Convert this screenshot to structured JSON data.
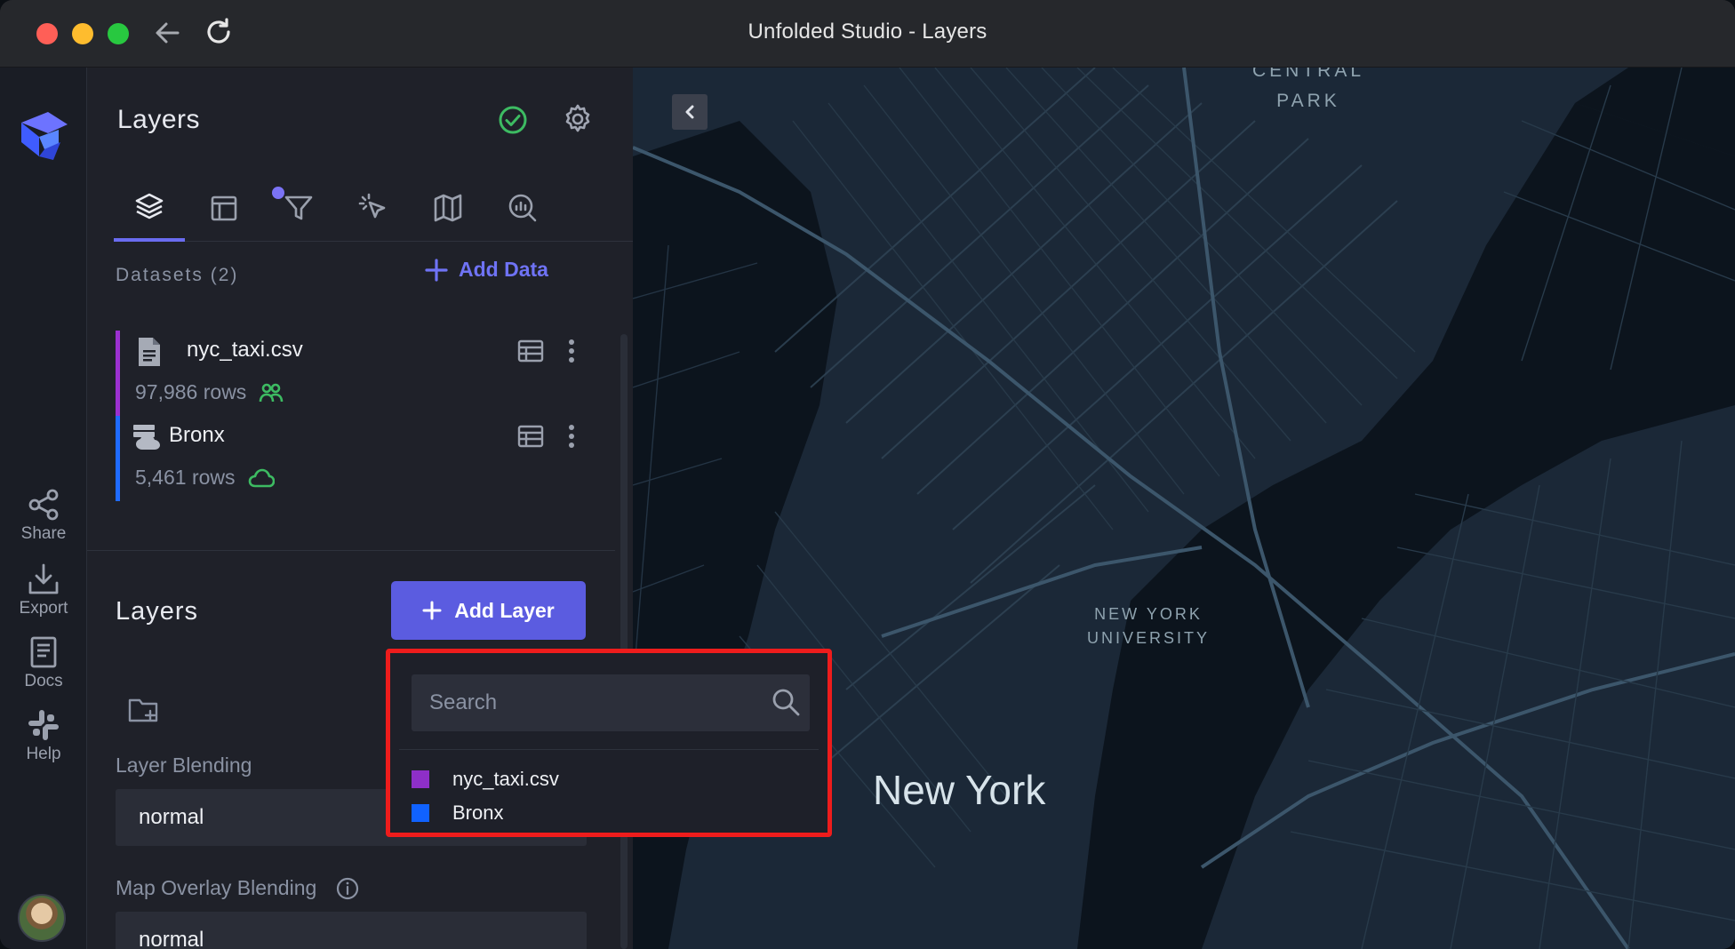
{
  "window": {
    "title": "Unfolded Studio - Layers"
  },
  "rail": {
    "items": [
      {
        "label": "Share",
        "icon": "share-icon"
      },
      {
        "label": "Export",
        "icon": "export-icon"
      },
      {
        "label": "Docs",
        "icon": "docs-icon"
      },
      {
        "label": "Help",
        "icon": "slack-icon"
      }
    ]
  },
  "panel": {
    "title": "Layers",
    "tabs": [
      {
        "name": "layers",
        "icon": "layers-icon"
      },
      {
        "name": "base-map",
        "icon": "layout-icon"
      },
      {
        "name": "filters",
        "icon": "filter-icon"
      },
      {
        "name": "interactions",
        "icon": "cursor-icon"
      },
      {
        "name": "map-style",
        "icon": "map-icon"
      },
      {
        "name": "analytics",
        "icon": "analytics-icon"
      }
    ],
    "datasets_header": "Datasets (2)",
    "add_data_label": "Add Data",
    "datasets": [
      {
        "name": "nyc_taxi.csv",
        "rows": "97,986 rows",
        "color": "#9b30d0"
      },
      {
        "name": "Bronx",
        "rows": "5,461 rows",
        "color": "#1f6bff"
      }
    ],
    "layers_title": "Layers",
    "add_layer_label": "Add Layer",
    "layer_blending_label": "Layer Blending",
    "layer_blending_value": "normal",
    "overlay_blending_label": "Map Overlay Blending",
    "overlay_blending_value": "normal"
  },
  "dropdown": {
    "search_placeholder": "Search",
    "items": [
      {
        "label": "nyc_taxi.csv",
        "color": "#8e2fc8"
      },
      {
        "label": "Bronx",
        "color": "#1062ff"
      }
    ]
  },
  "map": {
    "labels": {
      "central_park_1": "CENTRAL",
      "central_park_2": "PARK",
      "nyu_1": "NEW YORK",
      "nyu_2": "UNIVERSITY",
      "city": "New York"
    }
  }
}
